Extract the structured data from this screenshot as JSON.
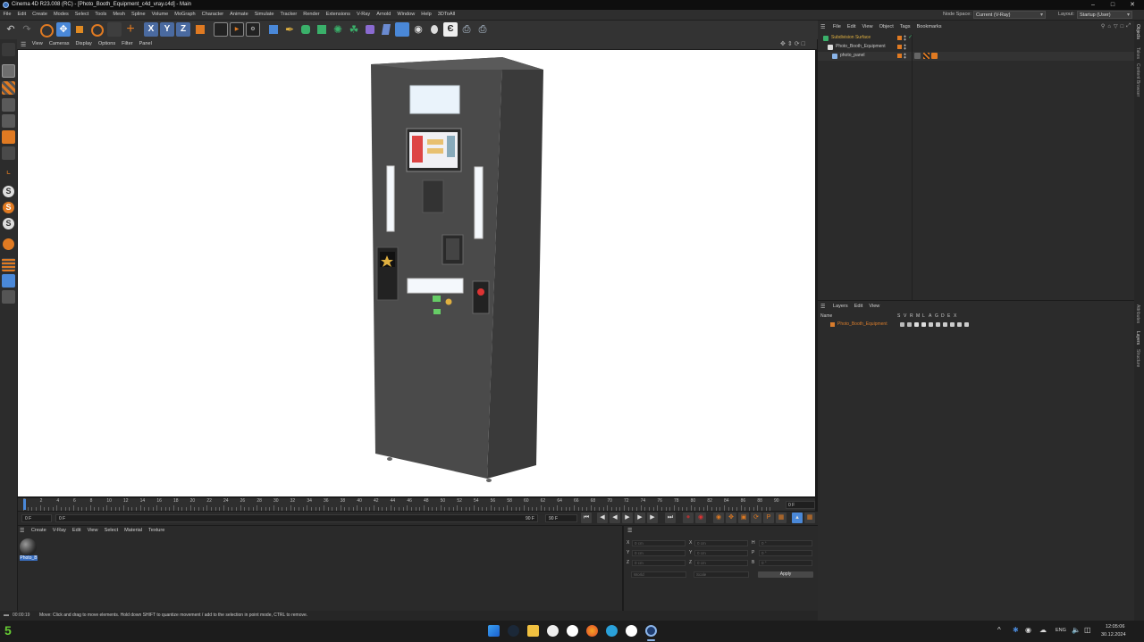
{
  "window": {
    "title": "Cinema 4D R23.008 (RC) - [Photo_Booth_Equipment_c4d_vray.c4d] - Main",
    "node_space_label": "Node Space:",
    "node_space_value": "Current (V-Ray)",
    "layout_label": "Layout:",
    "layout_value": "Startup (User)"
  },
  "menu": [
    "File",
    "Edit",
    "Create",
    "Modes",
    "Select",
    "Tools",
    "Mesh",
    "Spline",
    "Volume",
    "MoGraph",
    "Character",
    "Animate",
    "Simulate",
    "Tracker",
    "Render",
    "Extensions",
    "V-Ray",
    "Arnold",
    "Window",
    "Help",
    "3DToAll"
  ],
  "viewport_menu": [
    "View",
    "Cameras",
    "Display",
    "Options",
    "Filter",
    "Panel"
  ],
  "timeline": {
    "ticks": [
      "0",
      "2",
      "4",
      "6",
      "8",
      "10",
      "12",
      "14",
      "16",
      "18",
      "20",
      "22",
      "24",
      "26",
      "28",
      "30",
      "32",
      "34",
      "36",
      "38",
      "40",
      "42",
      "44",
      "46",
      "48",
      "50",
      "52",
      "54",
      "56",
      "58",
      "60",
      "62",
      "64",
      "66",
      "68",
      "70",
      "72",
      "74",
      "76",
      "78",
      "80",
      "82",
      "84",
      "86",
      "88",
      "90"
    ],
    "current_frame": "0 F",
    "start": "0 F",
    "range_start": "0 F",
    "range_end": "90 F",
    "end": "90 F"
  },
  "material_manager": {
    "menu": [
      "Create",
      "V-Ray",
      "Edit",
      "View",
      "Select",
      "Material",
      "Texture"
    ],
    "materials": [
      {
        "label": "Photo_B"
      }
    ]
  },
  "coordinates": {
    "rows": [
      {
        "a": "X",
        "av": "0 cm",
        "b": "X",
        "bv": "0 cm",
        "c": "H",
        "cv": "0 °"
      },
      {
        "a": "Y",
        "av": "0 cm",
        "b": "Y",
        "bv": "0 cm",
        "c": "P",
        "cv": "0 °"
      },
      {
        "a": "Z",
        "av": "0 cm",
        "b": "Z",
        "bv": "0 cm",
        "c": "B",
        "cv": "0 °"
      }
    ],
    "mode_world": "World",
    "mode_scale": "Scale",
    "apply": "Apply"
  },
  "status": {
    "time": "00:00:19",
    "message": "Move: Click and drag to move elements. Hold down SHIFT to quantize movement / add to the selection in point mode, CTRL to remove."
  },
  "object_manager": {
    "menu": [
      "File",
      "Edit",
      "View",
      "Object",
      "Tags",
      "Bookmarks"
    ],
    "objects": [
      {
        "name": "Subdivision Surface",
        "color": "#e0b040"
      },
      {
        "name": "Photo_Booth_Equipment",
        "color": "#c8c8c8"
      },
      {
        "name": "photo_panel",
        "color": "#c8c8c8"
      }
    ]
  },
  "layer_manager": {
    "menu": [
      "Layers",
      "Edit",
      "View"
    ],
    "header_name": "Name",
    "header_flags": [
      "S",
      "V",
      "R",
      "M",
      "L",
      "A",
      "G",
      "D",
      "E",
      "X"
    ],
    "layers": [
      {
        "name": "Photo_Booth_Equipment",
        "color": "#d87c2c"
      }
    ]
  },
  "right_tabs": [
    "Objects",
    "Takes",
    "Content Browser",
    "Attributes",
    "Layers",
    "Structure"
  ],
  "taskbar": {
    "start_label": "5",
    "lang": "ENG",
    "clock_time": "12:05:06",
    "clock_date": "30.12.2024"
  },
  "colors": {
    "accent_orange": "#e07a22",
    "accent_blue": "#4a88d8",
    "bg_dark": "#2b2b2b",
    "viewport_bg": "#ffffff"
  }
}
